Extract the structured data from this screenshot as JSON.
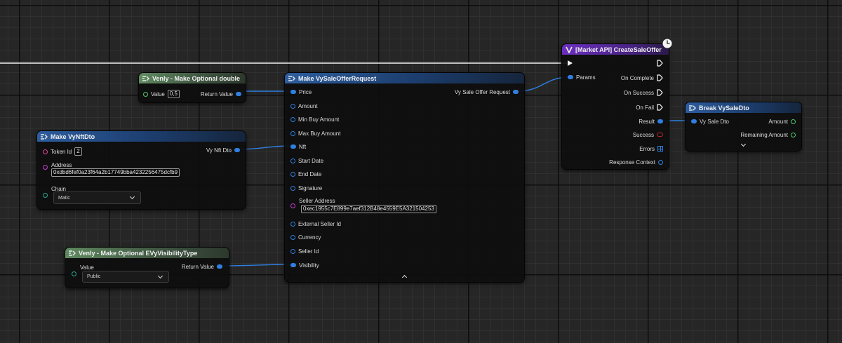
{
  "nodes": {
    "make_optional_double": {
      "title": "Venly - Make Optional double",
      "value_label": "Value",
      "value": "0,5",
      "return_label": "Return Value"
    },
    "make_nft_dto": {
      "title": "Make VyNftDto",
      "token_id_label": "Token Id",
      "token_id": "2",
      "address_label": "Address",
      "address": "0xdbd6fef0a23f64a2b17749bba4232256475dcfb9",
      "chain_label": "Chain",
      "chain": "Matic",
      "output_label": "Vy Nft Dto"
    },
    "make_optional_visibility": {
      "title": "Venly - Make Optional EVyVisibilityType",
      "value_label": "Value",
      "value": "Public",
      "return_label": "Return Value"
    },
    "make_sale_offer_request": {
      "title": "Make VySaleOfferRequest",
      "output_label": "Vy Sale Offer Request",
      "pins": [
        "Price",
        "Amount",
        "Min Buy Amount",
        "Max Buy Amount",
        "Nft",
        "Start Date",
        "End Date",
        "Signature",
        "Seller Address",
        "External Seller Id",
        "Currency",
        "Seller Id",
        "Visibility"
      ],
      "seller_address_value": "0xec1955c7E899e7aef312B48e4559E5A321504253"
    },
    "create_sale_offer": {
      "title": "[Market API] CreateSaleOffer",
      "params_label": "Params",
      "outputs": [
        "On Complete",
        "On Success",
        "On Fail",
        "Result",
        "Success",
        "Errors",
        "Response Context"
      ]
    },
    "break_sale_dto": {
      "title": "Break VySaleDto",
      "input_label": "Vy Sale Dto",
      "outputs": [
        "Amount",
        "Remaining Amount"
      ]
    }
  },
  "icons": {
    "function": "function-icon",
    "struct": "struct-icon",
    "venly": "venly-logo-icon",
    "latent": "clock-icon"
  },
  "colors": {
    "struct_pin": "#2f7fe0",
    "string_pin": "#c93ad1",
    "byte_pin": "#2ea58e",
    "int_pin": "#4fc76a",
    "bool_pin": "#b3262b",
    "exec": "#f4f4f4",
    "header_green": "#5f8a60",
    "header_blue": "#2d5d9e",
    "header_purple": "#6b2fbf"
  }
}
